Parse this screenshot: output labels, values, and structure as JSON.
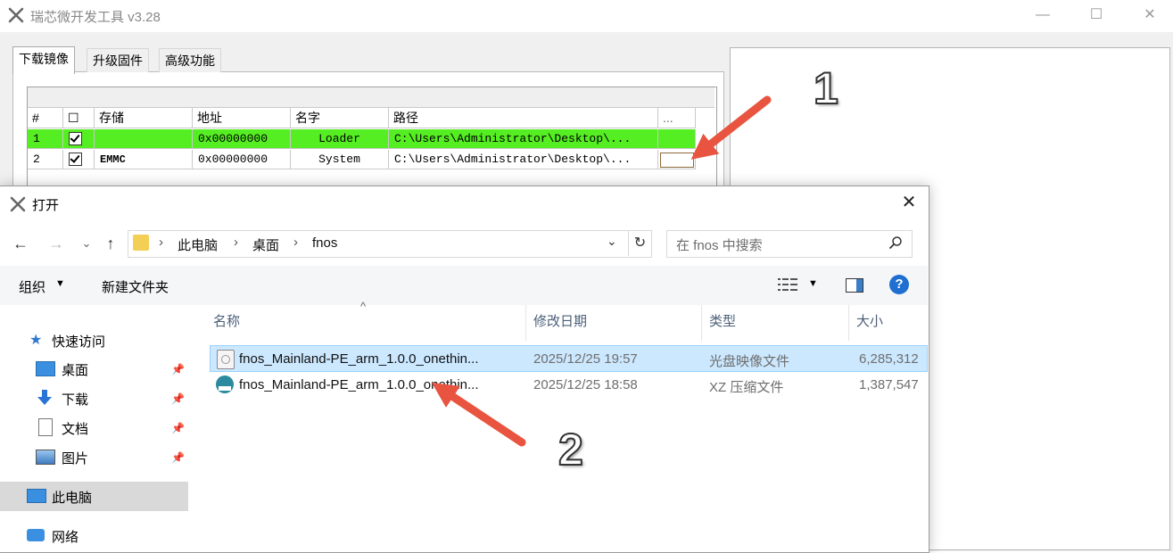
{
  "app": {
    "title": "瑞芯微开发工具 v3.28",
    "window_buttons": {
      "minimize": "—",
      "maximize": "☐",
      "close": "✕"
    },
    "tabs": [
      {
        "label": "下载镜像",
        "active": true
      },
      {
        "label": "升级固件",
        "active": false
      },
      {
        "label": "高级功能",
        "active": false
      }
    ],
    "grid": {
      "columns": [
        "#",
        "☐",
        "存储",
        "地址",
        "名字",
        "路径",
        "..."
      ],
      "rows": [
        {
          "index": "1",
          "storage": "",
          "address": "0x00000000",
          "name": "Loader",
          "path": "C:\\Users\\Administrator\\Desktop\\...",
          "checked": true,
          "highlight": "#55ee22"
        },
        {
          "index": "2",
          "storage": "EMMC",
          "address": "0x00000000",
          "name": "System",
          "path": "C:\\Users\\Administrator\\Desktop\\...",
          "checked": true,
          "highlight": ""
        }
      ]
    }
  },
  "dialog": {
    "title": "打开",
    "close": "✕",
    "nav": {
      "back": "←",
      "forward": "→",
      "recent": "⌄",
      "up": "↑"
    },
    "breadcrumb": [
      "此电脑",
      "桌面",
      "fnos"
    ],
    "breadcrumb_sep": "›",
    "address_dropdown": "⌄",
    "refresh": "↻",
    "search_placeholder": "在 fnos 中搜索",
    "toolbar": {
      "organize": "组织",
      "organize_caret": "▼",
      "new_folder": "新建文件夹",
      "view_caret": "▼",
      "help": "?"
    },
    "sidebar": {
      "quick_access": "快速访问",
      "items": [
        {
          "label": "桌面",
          "pinned": true
        },
        {
          "label": "下载",
          "pinned": true
        },
        {
          "label": "文档",
          "pinned": true
        },
        {
          "label": "图片",
          "pinned": true
        }
      ],
      "this_pc": "此电脑",
      "network": "网络"
    },
    "columns": {
      "name": "名称",
      "modified": "修改日期",
      "type": "类型",
      "size": "大小",
      "sort_indicator": "^"
    },
    "files": [
      {
        "name": "fnos_Mainland-PE_arm_1.0.0_onethin...",
        "modified": "2025/12/25 19:57",
        "type": "光盘映像文件",
        "size": "6,285,312",
        "selected": true,
        "icon": "disc-image-icon"
      },
      {
        "name": "fnos_Mainland-PE_arm_1.0.0_onethin...",
        "modified": "2025/12/25 18:58",
        "type": "XZ 压缩文件",
        "size": "1,387,547",
        "selected": false,
        "icon": "xz-archive-icon"
      }
    ]
  },
  "annotations": [
    {
      "label": "1",
      "color": "#e8543f"
    },
    {
      "label": "2",
      "color": "#e8543f"
    }
  ],
  "colors": {
    "accent_blue": "#1f6fd0",
    "row_green": "#55ee22",
    "selection": "#cce8ff",
    "arrow": "#e8543f"
  }
}
